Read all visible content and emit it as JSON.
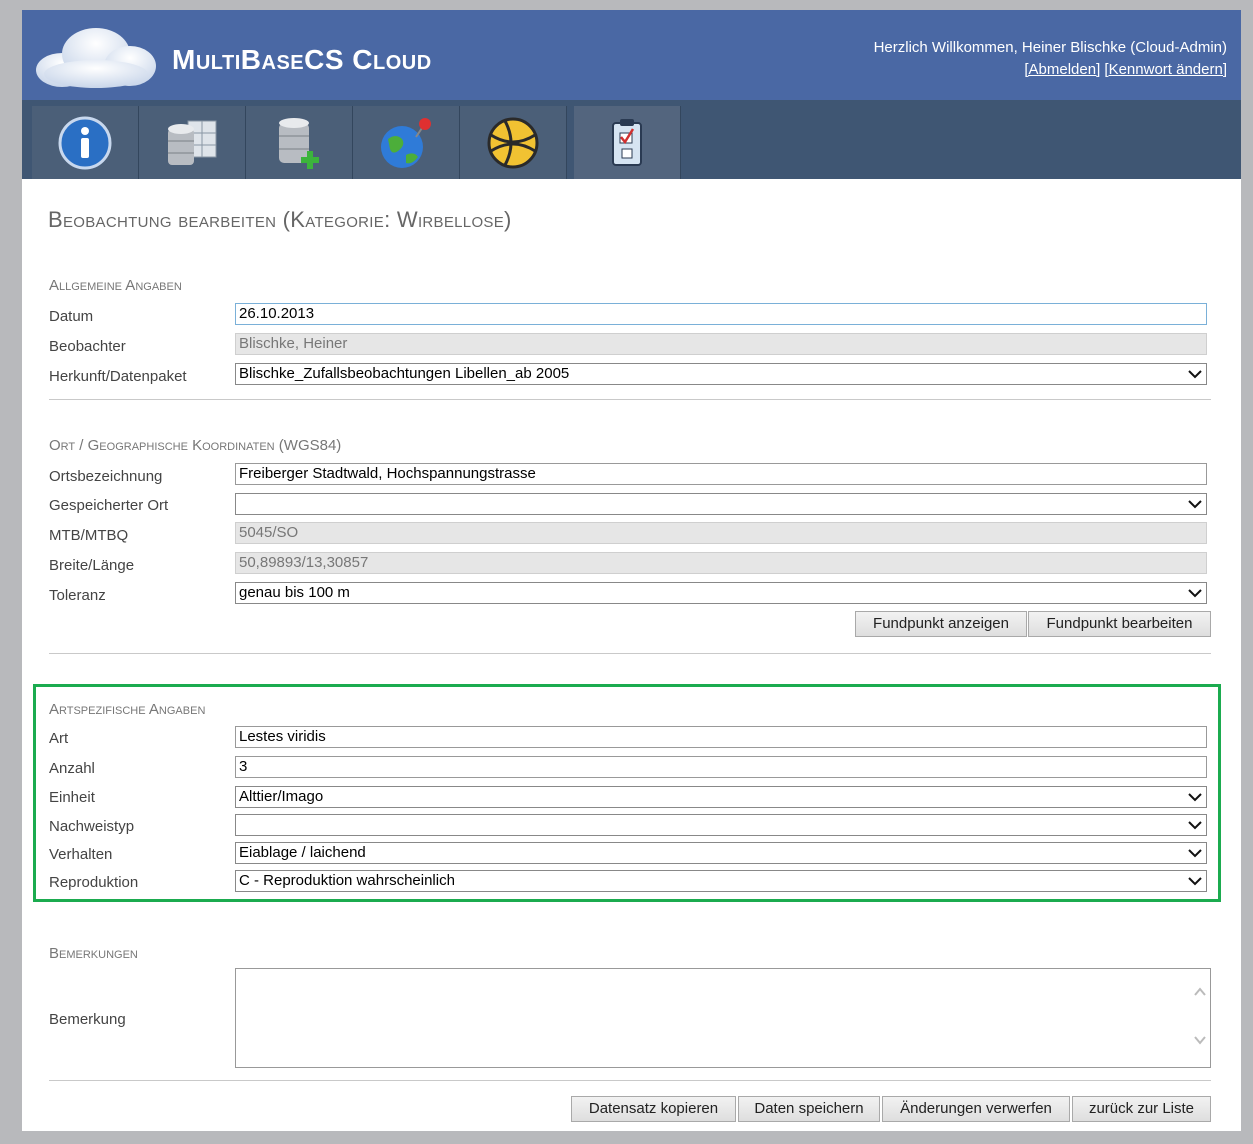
{
  "header": {
    "app_title": "MultiBaseCS Cloud",
    "welcome": "Herzlich Willkommen, Heiner Blischke (Cloud-Admin)",
    "logout_link": "[Abmelden]",
    "change_password_link": "[Kennwort ändern]"
  },
  "nav": {
    "tabs": [
      {
        "icon": "info-icon"
      },
      {
        "icon": "database-table-icon"
      },
      {
        "icon": "database-add-icon"
      },
      {
        "icon": "globe-pin-icon"
      },
      {
        "icon": "grid-globe-icon"
      },
      {
        "icon": "clipboard-check-icon",
        "active": true
      }
    ]
  },
  "page": {
    "title": "Beobachtung bearbeiten (Kategorie: Wirbellose)"
  },
  "general": {
    "title": "Allgemeine Angaben",
    "datum_label": "Datum",
    "datum_value": "26.10.2013",
    "beobachter_label": "Beobachter",
    "beobachter_value": "Blischke, Heiner",
    "herkunft_label": "Herkunft/Datenpaket",
    "herkunft_value": "Blischke_Zufallsbeobachtungen Libellen_ab 2005"
  },
  "location": {
    "title": "Ort / Geographische Koordinaten (WGS84)",
    "ort_label": "Ortsbezeichnung",
    "ort_value": "Freiberger Stadtwald, Hochspannungstrasse",
    "gespeichert_label": "Gespeicherter Ort",
    "gespeichert_value": "",
    "mtb_label": "MTB/MTBQ",
    "mtb_value": "5045/SO",
    "breite_label": "Breite/Länge",
    "breite_value": "50,89893/13,30857",
    "toleranz_label": "Toleranz",
    "toleranz_value": "genau bis 100 m",
    "btn_show": "Fundpunkt anzeigen",
    "btn_edit": "Fundpunkt bearbeiten"
  },
  "species": {
    "title": "Artspezifische Angaben",
    "art_label": "Art",
    "art_value": "Lestes viridis",
    "anzahl_label": "Anzahl",
    "anzahl_value": "3",
    "einheit_label": "Einheit",
    "einheit_value": "Alttier/Imago",
    "nachweis_label": "Nachweistyp",
    "nachweis_value": "",
    "verhalten_label": "Verhalten",
    "verhalten_value": "Eiablage / laichend",
    "repro_label": "Reproduktion",
    "repro_value": "C - Reproduktion wahrscheinlich"
  },
  "remarks": {
    "title": "Bemerkungen",
    "label": "Bemerkung",
    "value": ""
  },
  "footer": {
    "copy": "Datensatz kopieren",
    "save": "Daten speichern",
    "discard": "Änderungen verwerfen",
    "back": "zurück zur Liste"
  },
  "colors": {
    "header_bg": "#4a68a4",
    "nav_bg": "#3f5673",
    "highlight": "#1bab4f"
  }
}
